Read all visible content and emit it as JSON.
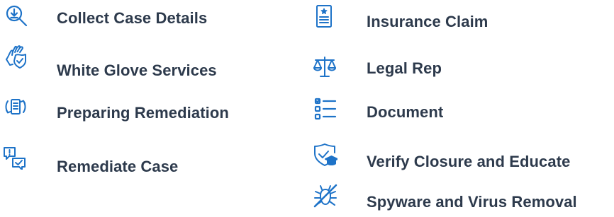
{
  "colors": {
    "icon_blue": "#1e73c8",
    "text": "#2d3a4c"
  },
  "left_column": [
    {
      "label": "Collect Case Details",
      "icon": "magnifier-download-icon"
    },
    {
      "label": "White Glove Services",
      "icon": "hand-heart-shield-icon"
    },
    {
      "label": "Preparing Remediation",
      "icon": "document-refresh-icon"
    },
    {
      "label": "Remediate Case",
      "icon": "chat-alert-check-icon"
    }
  ],
  "right_column": [
    {
      "label": "Insurance Claim",
      "icon": "policy-document-icon"
    },
    {
      "label": "Legal Rep",
      "icon": "scales-icon"
    },
    {
      "label": "Document",
      "icon": "checklist-icon"
    },
    {
      "label": "Verify Closure and Educate",
      "icon": "shield-graduation-icon"
    },
    {
      "label": "Spyware and Virus Removal",
      "icon": "bug-crossed-icon"
    }
  ]
}
